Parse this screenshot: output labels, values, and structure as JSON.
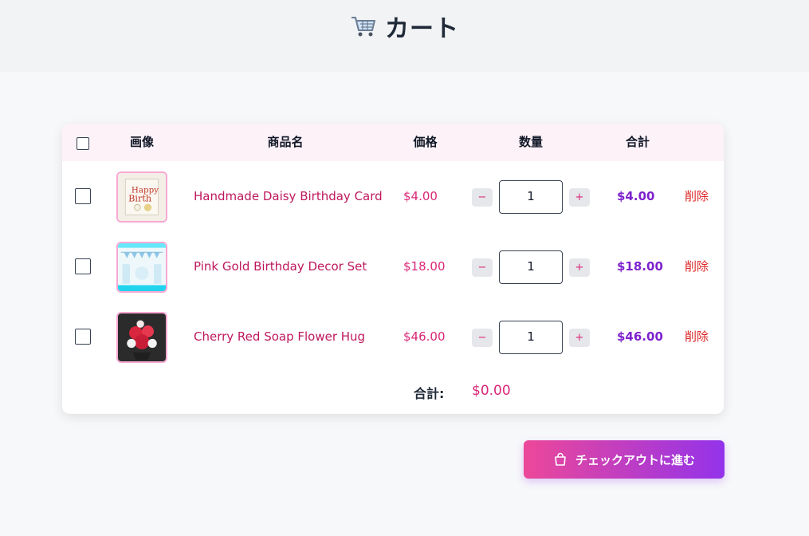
{
  "header": {
    "title": "カート",
    "icon": "shopping-cart-icon"
  },
  "table": {
    "columns": {
      "image": "画像",
      "name": "商品名",
      "price": "価格",
      "quantity": "数量",
      "total": "合計"
    },
    "items": [
      {
        "name": "Handmade Daisy Birthday Card",
        "price": "$4.00",
        "quantity": "1",
        "subtotal": "$4.00",
        "delete": "削除",
        "minus": "−",
        "plus": "+"
      },
      {
        "name": "Pink Gold Birthday Decor Set",
        "price": "$18.00",
        "quantity": "1",
        "subtotal": "$18.00",
        "delete": "削除",
        "minus": "−",
        "plus": "+"
      },
      {
        "name": "Cherry Red Soap Flower Hug",
        "price": "$46.00",
        "quantity": "1",
        "subtotal": "$46.00",
        "delete": "削除",
        "minus": "−",
        "plus": "+"
      }
    ],
    "total_label": "合計:",
    "total_value": "$0.00"
  },
  "checkout": {
    "label": "チェックアウトに進む",
    "icon": "shopping-bag-icon"
  },
  "colors": {
    "accent_pink": "#db2777",
    "accent_purple": "#7e22ce",
    "delete_red": "#dc2626",
    "gradient_start": "#ec4899",
    "gradient_end": "#9333ea"
  }
}
